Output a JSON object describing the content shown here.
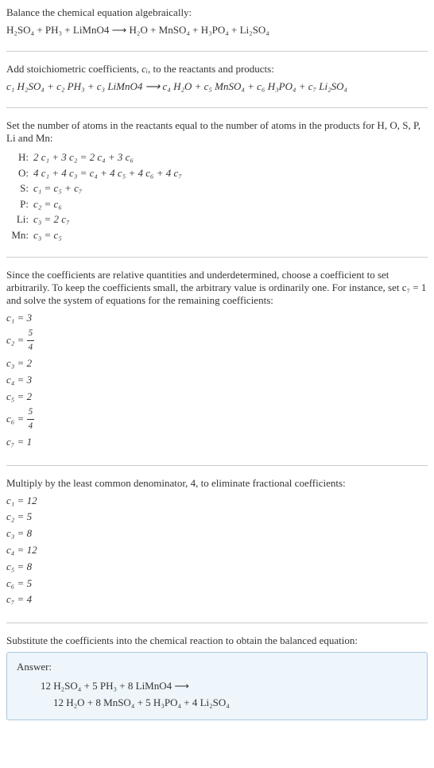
{
  "intro": {
    "line1": "Balance the chemical equation algebraically:",
    "equation": "H₂SO₄ + PH₃ + LiMnO4 ⟶ H₂O + MnSO₄ + H₃PO₄ + Li₂SO₄"
  },
  "stoich": {
    "line1_part1": "Add stoichiometric coefficients, ",
    "line1_ci": "cᵢ",
    "line1_part2": ", to the reactants and products:",
    "equation": "c₁ H₂SO₄ + c₂ PH₃ + c₃ LiMnO4 ⟶ c₄ H₂O + c₅ MnSO₄ + c₆ H₃PO₄ + c₇ Li₂SO₄"
  },
  "atoms": {
    "intro": "Set the number of atoms in the reactants equal to the number of atoms in the products for H, O, S, P, Li and Mn:",
    "rows": [
      {
        "label": "H:",
        "eq": "2 c₁ + 3 c₂ = 2 c₄ + 3 c₆"
      },
      {
        "label": "O:",
        "eq": "4 c₁ + 4 c₃ = c₄ + 4 c₅ + 4 c₆ + 4 c₇"
      },
      {
        "label": "S:",
        "eq": "c₁ = c₅ + c₇"
      },
      {
        "label": "P:",
        "eq": "c₂ = c₆"
      },
      {
        "label": "Li:",
        "eq": "c₃ = 2 c₇"
      },
      {
        "label": "Mn:",
        "eq": "c₃ = c₅"
      }
    ]
  },
  "solve": {
    "intro": "Since the coefficients are relative quantities and underdetermined, choose a coefficient to set arbitrarily. To keep the coefficients small, the arbitrary value is ordinarily one. For instance, set c₇ = 1 and solve the system of equations for the remaining coefficients:",
    "coeffs": [
      {
        "lhs": "c₁",
        "val": "3",
        "frac": null
      },
      {
        "lhs": "c₂",
        "val": null,
        "frac": {
          "num": "5",
          "den": "4"
        }
      },
      {
        "lhs": "c₃",
        "val": "2",
        "frac": null
      },
      {
        "lhs": "c₄",
        "val": "3",
        "frac": null
      },
      {
        "lhs": "c₅",
        "val": "2",
        "frac": null
      },
      {
        "lhs": "c₆",
        "val": null,
        "frac": {
          "num": "5",
          "den": "4"
        }
      },
      {
        "lhs": "c₇",
        "val": "1",
        "frac": null
      }
    ]
  },
  "multiply": {
    "intro": "Multiply by the least common denominator, 4, to eliminate fractional coefficients:",
    "coeffs": [
      {
        "lhs": "c₁",
        "val": "12"
      },
      {
        "lhs": "c₂",
        "val": "5"
      },
      {
        "lhs": "c₃",
        "val": "8"
      },
      {
        "lhs": "c₄",
        "val": "12"
      },
      {
        "lhs": "c₅",
        "val": "8"
      },
      {
        "lhs": "c₆",
        "val": "5"
      },
      {
        "lhs": "c₇",
        "val": "4"
      }
    ]
  },
  "final": {
    "intro": "Substitute the coefficients into the chemical reaction to obtain the balanced equation:",
    "answer_label": "Answer:",
    "answer_line1": "12 H₂SO₄ + 5 PH₃ + 8 LiMnO4 ⟶",
    "answer_line2": "12 H₂O + 8 MnSO₄ + 5 H₃PO₄ + 4 Li₂SO₄"
  }
}
